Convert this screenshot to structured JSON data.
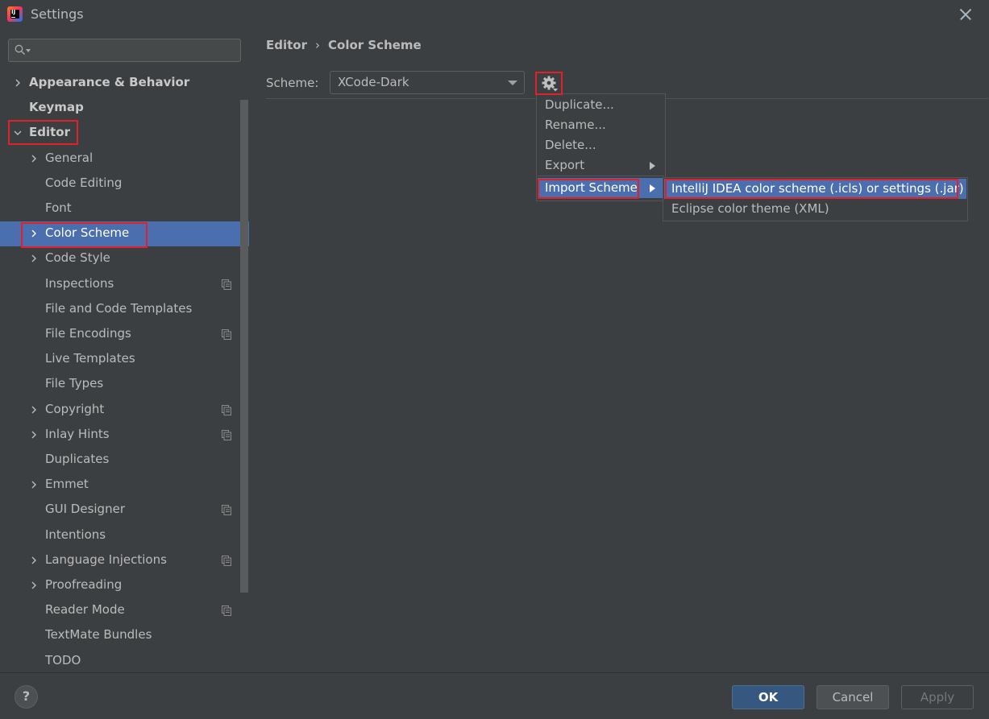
{
  "window": {
    "title": "Settings"
  },
  "search": {
    "placeholder": ""
  },
  "tree": [
    {
      "label": "Appearance & Behavior",
      "bold": true,
      "level": 0,
      "chevron": "right",
      "project": false,
      "selected": false
    },
    {
      "label": "Keymap",
      "bold": true,
      "level": 0,
      "chevron": "none",
      "project": false,
      "selected": false
    },
    {
      "label": "Editor",
      "bold": true,
      "level": 0,
      "chevron": "down",
      "project": false,
      "selected": false
    },
    {
      "label": "General",
      "bold": false,
      "level": 1,
      "chevron": "right",
      "project": false,
      "selected": false
    },
    {
      "label": "Code Editing",
      "bold": false,
      "level": 1,
      "chevron": "none",
      "project": false,
      "selected": false
    },
    {
      "label": "Font",
      "bold": false,
      "level": 1,
      "chevron": "none",
      "project": false,
      "selected": false
    },
    {
      "label": "Color Scheme",
      "bold": false,
      "level": 1,
      "chevron": "right",
      "project": false,
      "selected": true
    },
    {
      "label": "Code Style",
      "bold": false,
      "level": 1,
      "chevron": "right",
      "project": false,
      "selected": false
    },
    {
      "label": "Inspections",
      "bold": false,
      "level": 1,
      "chevron": "none",
      "project": true,
      "selected": false
    },
    {
      "label": "File and Code Templates",
      "bold": false,
      "level": 1,
      "chevron": "none",
      "project": false,
      "selected": false
    },
    {
      "label": "File Encodings",
      "bold": false,
      "level": 1,
      "chevron": "none",
      "project": true,
      "selected": false
    },
    {
      "label": "Live Templates",
      "bold": false,
      "level": 1,
      "chevron": "none",
      "project": false,
      "selected": false
    },
    {
      "label": "File Types",
      "bold": false,
      "level": 1,
      "chevron": "none",
      "project": false,
      "selected": false
    },
    {
      "label": "Copyright",
      "bold": false,
      "level": 1,
      "chevron": "right",
      "project": true,
      "selected": false
    },
    {
      "label": "Inlay Hints",
      "bold": false,
      "level": 1,
      "chevron": "right",
      "project": true,
      "selected": false
    },
    {
      "label": "Duplicates",
      "bold": false,
      "level": 1,
      "chevron": "none",
      "project": false,
      "selected": false
    },
    {
      "label": "Emmet",
      "bold": false,
      "level": 1,
      "chevron": "right",
      "project": false,
      "selected": false
    },
    {
      "label": "GUI Designer",
      "bold": false,
      "level": 1,
      "chevron": "none",
      "project": true,
      "selected": false
    },
    {
      "label": "Intentions",
      "bold": false,
      "level": 1,
      "chevron": "none",
      "project": false,
      "selected": false
    },
    {
      "label": "Language Injections",
      "bold": false,
      "level": 1,
      "chevron": "right",
      "project": true,
      "selected": false
    },
    {
      "label": "Proofreading",
      "bold": false,
      "level": 1,
      "chevron": "right",
      "project": false,
      "selected": false
    },
    {
      "label": "Reader Mode",
      "bold": false,
      "level": 1,
      "chevron": "none",
      "project": true,
      "selected": false
    },
    {
      "label": "TextMate Bundles",
      "bold": false,
      "level": 1,
      "chevron": "none",
      "project": false,
      "selected": false
    },
    {
      "label": "TODO",
      "bold": false,
      "level": 1,
      "chevron": "none",
      "project": false,
      "selected": false
    }
  ],
  "breadcrumb": {
    "parent": "Editor",
    "separator": "›",
    "current": "Color Scheme"
  },
  "scheme": {
    "label": "Scheme:",
    "value": "XCode-Dark"
  },
  "gear_menu": {
    "items": [
      {
        "label": "Duplicate...",
        "submenu": false,
        "active": false
      },
      {
        "label": "Rename...",
        "submenu": false,
        "active": false
      },
      {
        "label": "Delete...",
        "submenu": false,
        "active": false
      },
      {
        "label": "Export",
        "submenu": true,
        "active": false
      },
      {
        "label": "Import Scheme",
        "submenu": true,
        "active": true
      }
    ]
  },
  "import_submenu": {
    "items": [
      {
        "label": "IntelliJ IDEA color scheme (.icls) or settings (.jar)",
        "active": true
      },
      {
        "label": "Eclipse color theme (XML)",
        "active": false
      }
    ]
  },
  "footer": {
    "help": "?",
    "ok": "OK",
    "cancel": "Cancel",
    "apply": "Apply"
  },
  "colors": {
    "background": "#3c3f41",
    "selection": "#4b6eaf",
    "text": "#bbbbbb",
    "highlight_box": "#e0202a",
    "ok_button": "#365880"
  },
  "icons": {
    "logo": "intellij-idea-logo",
    "search": "search-icon",
    "settings": "gear-icon",
    "close": "close-icon",
    "project_scope": "project-scope-icon"
  }
}
